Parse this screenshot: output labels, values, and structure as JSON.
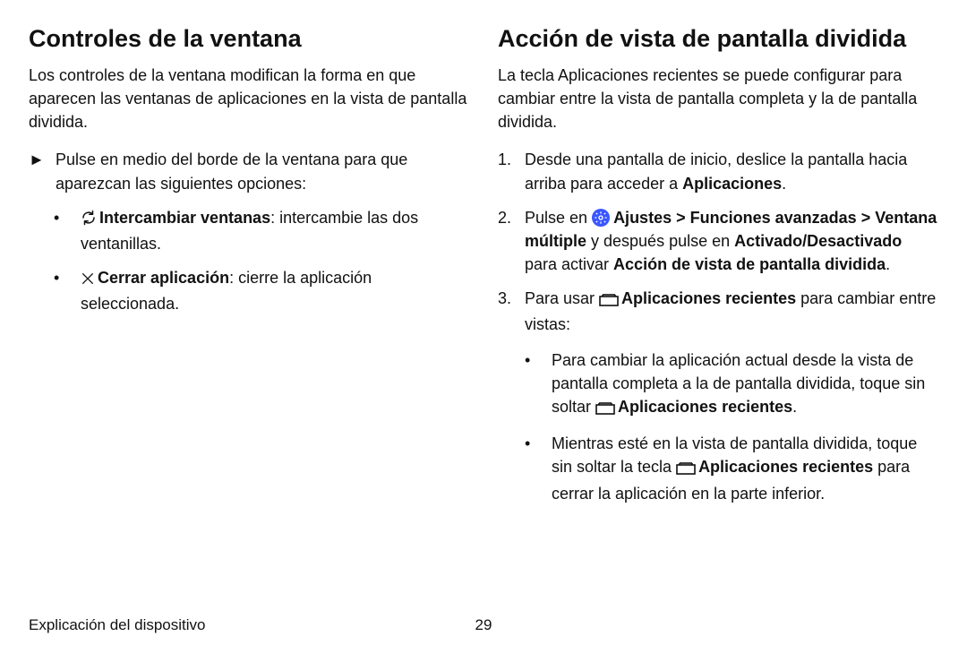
{
  "left": {
    "heading": "Controles de la ventana",
    "lead": "Los controles de la ventana modifican la forma en que aparecen las ventanas de aplicaciones en la vista de pantalla dividida.",
    "tri_text": "Pulse en medio del borde de la ventana para que aparezcan las siguientes opciones:",
    "bullet1_strong": "Intercambiar ventanas",
    "bullet1_rest": ": intercambie las dos ventanillas.",
    "bullet2_strong": "Cerrar aplicación",
    "bullet2_rest": ": cierre la aplicación seleccionada."
  },
  "right": {
    "heading": "Acción de vista de pantalla dividida",
    "lead": "La tecla Aplicaciones recientes se puede configurar para cambiar entre la vista de pantalla completa y la de pantalla dividida.",
    "step1_a": "Desde una pantalla de inicio, deslice la pantalla hacia arriba para acceder a ",
    "step1_b": "Aplicaciones",
    "step1_c": ".",
    "step2_a": "Pulse en ",
    "step2_b": "Ajustes",
    "step2_c": " > ",
    "step2_d": "Funciones avanzadas",
    "step2_e": " > ",
    "step2_f": "Ventana múltiple",
    "step2_g": " y después pulse en ",
    "step2_h": "Activado/​Desactivado",
    "step2_i": " para activar ",
    "step2_j": "Acción de vista de pantalla dividida",
    "step2_k": ".",
    "step3_a": "Para usar ",
    "step3_b": "Aplicaciones recientes",
    "step3_c": " para cambiar entre vistas:",
    "sub1_a": "Para cambiar la aplicación actual desde la vista de pantalla completa a la de pantalla dividida, toque sin soltar ",
    "sub1_b": "Aplicaciones recientes",
    "sub1_c": ".",
    "sub2_a": "Mientras esté en la vista de pantalla dividida, toque sin soltar la tecla ",
    "sub2_b": "Aplicaciones recientes",
    "sub2_c": " para cerrar la aplicación en la parte inferior."
  },
  "footer": {
    "section": "Explicación del dispositivo",
    "page": "29"
  },
  "markers": {
    "tri": "►",
    "dot": "•",
    "one": "1.",
    "two": "2.",
    "three": "3."
  }
}
